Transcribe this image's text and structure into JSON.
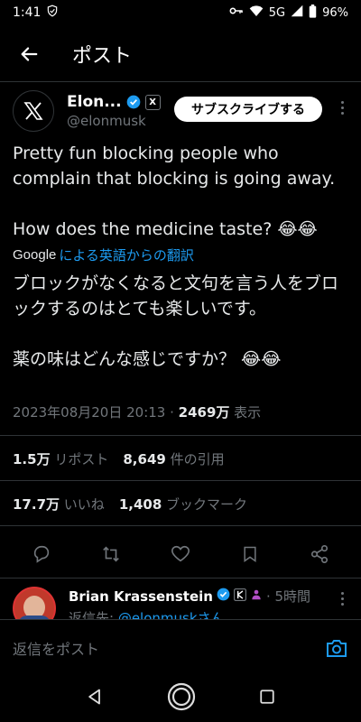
{
  "status_bar": {
    "time": "1:41",
    "network": "5G",
    "battery": "96%"
  },
  "header": {
    "title": "ポスト"
  },
  "author": {
    "name": "Elon...",
    "handle": "@elonmusk",
    "affiliate_badge": "X",
    "subscribe_label": "サブスクライブする"
  },
  "tweet": {
    "original_text": "Pretty fun blocking people who complain that blocking is going away.\n\nHow does the medicine taste? 😂😂",
    "translate_brand": "Google",
    "translate_label": "による英語からの翻訳",
    "translated_text": "ブロックがなくなると文句を言う人をブロックするのはとても楽しいです。\n\n薬の味はどんな感じですか？ 😂😂",
    "timestamp": "2023年08月20日 20:13 · ",
    "views_count": "2469万",
    "views_label": " 表示"
  },
  "stats": {
    "reposts_count": "1.5万",
    "reposts_label": "リポスト",
    "quotes_count": "8,649",
    "quotes_label": "件の引用",
    "likes_count": "17.7万",
    "likes_label": "いいね",
    "bookmarks_count": "1,408",
    "bookmarks_label": "ブックマーク"
  },
  "reply": {
    "name": "Brian Krassenstein",
    "time": "· 5時間",
    "reply_to_prefix": "返信先: ",
    "reply_to_handle": "@elonmuskさん"
  },
  "compose": {
    "placeholder": "返信をポスト"
  },
  "colors": {
    "accent": "#1d9bf0",
    "background": "#000000",
    "secondary_text": "#71767b"
  }
}
